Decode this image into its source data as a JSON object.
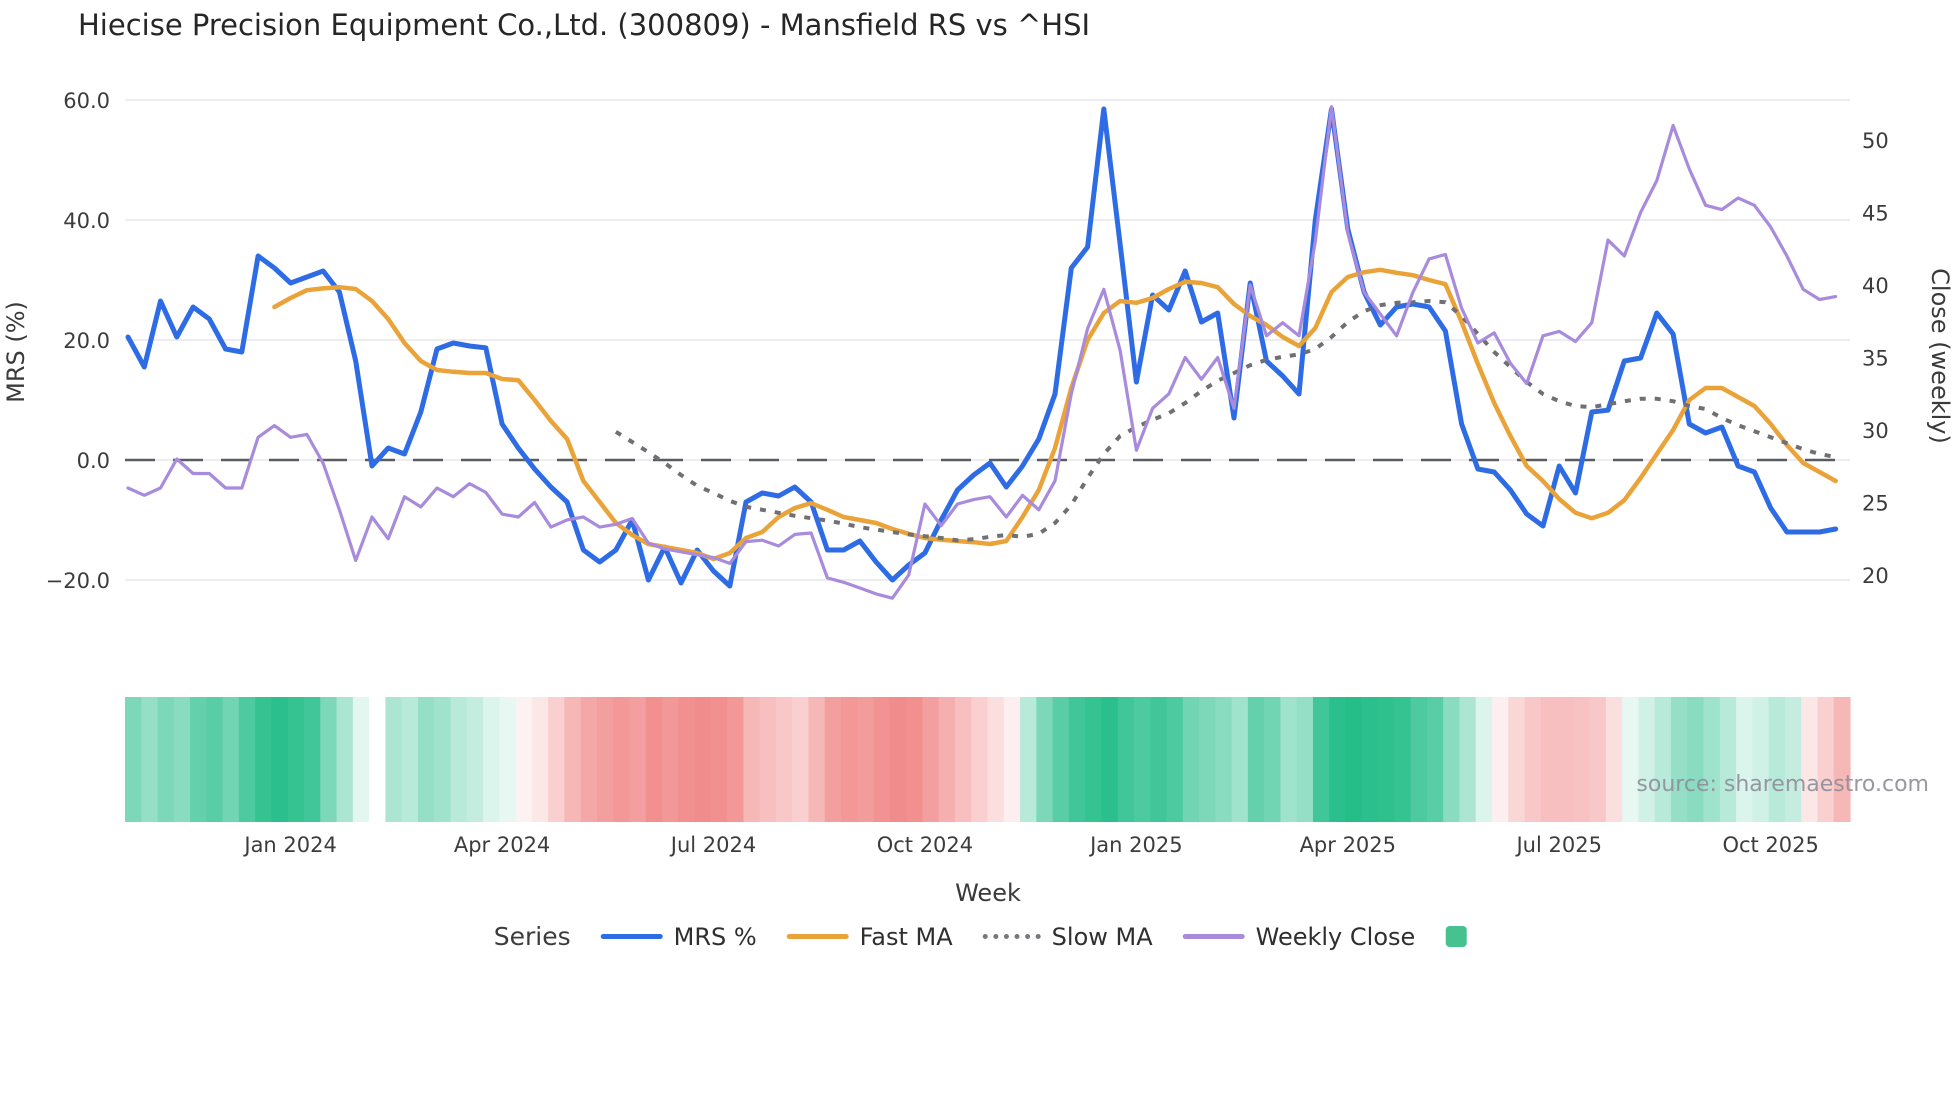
{
  "header": {
    "title": "Hiecise Precision Equipment Co.,Ltd. (300809) - Mansfield RS vs ^HSI"
  },
  "source_note": "source: sharemaestro.com",
  "legend": {
    "title": "Series",
    "items": [
      {
        "label": "MRS %",
        "swatch": "line",
        "color": "#2e6ce5"
      },
      {
        "label": "Fast MA",
        "swatch": "line",
        "color": "#eaa339"
      },
      {
        "label": "Slow MA",
        "swatch": "dotted",
        "color": "#77777c"
      },
      {
        "label": "Weekly Close",
        "swatch": "line",
        "color": "#a88bdc"
      },
      {
        "label": "",
        "swatch": "square",
        "color": "#45c28f"
      }
    ]
  },
  "chart_data": {
    "type": "line",
    "title": "Hiecise Precision Equipment Co.,Ltd. (300809) - Mansfield RS vs ^HSI",
    "xlabel": "Week",
    "x_tick_labels": [
      "Jan 2024",
      "Apr 2024",
      "Jul 2024",
      "Oct 2024",
      "Jan 2025",
      "Apr 2025",
      "Jul 2025",
      "Oct 2025"
    ],
    "x_tick_weeks": [
      10,
      23,
      36,
      49,
      62,
      75,
      88,
      101
    ],
    "weeks_total": 106,
    "grid": true,
    "y_left": {
      "label": "MRS (%)",
      "tick_labels": [
        "60.0",
        "40.0",
        "20.0",
        "0.0",
        "−20.0"
      ],
      "tick_values": [
        60,
        40,
        20,
        0,
        -20
      ],
      "zero_line": 0,
      "range": [
        -25,
        62
      ]
    },
    "y_right": {
      "label": "Close (weekly)",
      "tick_labels": [
        "50",
        "45",
        "40",
        "35",
        "30",
        "25",
        "20"
      ],
      "tick_values": [
        50,
        45,
        40,
        35,
        30,
        25,
        20
      ],
      "range": [
        18,
        53
      ]
    },
    "series": [
      {
        "name": "MRS %",
        "axis": "left",
        "color": "#2e6ce5",
        "style": "solid",
        "width": 5,
        "values": [
          20.5,
          15.5,
          26.5,
          20.5,
          25.5,
          23.5,
          18.5,
          18.0,
          34.0,
          32.0,
          29.5,
          30.5,
          31.5,
          28.0,
          16.5,
          -1.0,
          2.0,
          1.0,
          8.0,
          18.5,
          19.5,
          19.0,
          18.7,
          6.0,
          2.0,
          -1.5,
          -4.5,
          -7.0,
          -15.0,
          -17.0,
          -15.0,
          -10.0,
          -20.0,
          -14.5,
          -20.5,
          -15.0,
          -18.5,
          -21.0,
          -7.0,
          -5.5,
          -6.0,
          -4.5,
          -7.0,
          -15.0,
          -15.0,
          -13.5,
          -17.0,
          -20.0,
          -17.5,
          -15.5,
          -10.0,
          -5.0,
          -2.5,
          -0.5,
          -4.5,
          -1.0,
          3.5,
          11.0,
          32.0,
          35.5,
          58.5,
          36.0,
          13.0,
          27.5,
          25.0,
          31.5,
          23.0,
          24.5,
          7.0,
          29.5,
          16.5,
          14.0,
          11.0,
          40.0,
          58.5,
          38.5,
          28.0,
          22.5,
          25.5,
          26.0,
          25.5,
          21.5,
          6.0,
          -1.5,
          -2.0,
          -5.0,
          -9.0,
          -11.0,
          -1.0,
          -5.5,
          8.0,
          8.3,
          16.5,
          17.0,
          24.5,
          21.0,
          6.0,
          4.5,
          5.5,
          -1.0,
          -2.0,
          -8.0,
          -12.0,
          -12.0,
          -12.0,
          -11.5
        ]
      },
      {
        "name": "Fast MA",
        "axis": "left",
        "color": "#eaa339",
        "style": "solid",
        "width": 4.5,
        "values": [
          null,
          null,
          null,
          null,
          null,
          null,
          null,
          null,
          null,
          25.5,
          27.0,
          28.3,
          28.6,
          28.8,
          28.5,
          26.5,
          23.5,
          19.5,
          16.5,
          15.0,
          14.7,
          14.5,
          14.5,
          13.5,
          13.3,
          10.0,
          6.5,
          3.5,
          -3.5,
          -7.0,
          -10.5,
          -12.5,
          -14.0,
          -14.5,
          -15.0,
          -15.5,
          -16.5,
          -15.5,
          -13.0,
          -12.0,
          -9.5,
          -8.0,
          -7.2,
          -8.3,
          -9.5,
          -10.0,
          -10.5,
          -11.5,
          -12.3,
          -13.0,
          -13.3,
          -13.5,
          -13.7,
          -14.0,
          -13.5,
          -9.5,
          -5.0,
          2.0,
          12.0,
          20.0,
          24.5,
          26.5,
          26.2,
          27.0,
          28.5,
          29.7,
          29.5,
          28.8,
          26.0,
          24.0,
          22.5,
          20.5,
          19.0,
          22.0,
          28.0,
          30.5,
          31.3,
          31.7,
          31.2,
          30.8,
          30.0,
          29.3,
          23.0,
          16.0,
          9.5,
          4.0,
          -1.0,
          -3.5,
          -6.5,
          -8.8,
          -9.7,
          -8.8,
          -6.7,
          -3.0,
          1.0,
          5.0,
          10.0,
          12.0,
          12.0,
          10.5,
          9.0,
          6.0,
          2.5,
          -0.5,
          -2.0,
          -3.5
        ]
      },
      {
        "name": "Slow MA",
        "axis": "left",
        "color": "#6f6f74",
        "style": "dotted",
        "width": 4,
        "values": [
          null,
          null,
          null,
          null,
          null,
          null,
          null,
          null,
          null,
          null,
          null,
          null,
          null,
          null,
          null,
          null,
          null,
          null,
          null,
          null,
          null,
          null,
          null,
          null,
          null,
          null,
          null,
          null,
          null,
          null,
          4.7,
          3.0,
          1.3,
          -0.5,
          -2.5,
          -4.3,
          -5.5,
          -6.8,
          -7.8,
          -8.3,
          -8.8,
          -9.3,
          -9.7,
          -10.1,
          -10.6,
          -11.2,
          -11.6,
          -12.0,
          -12.4,
          -12.7,
          -13.0,
          -13.4,
          -13.2,
          -12.8,
          -12.5,
          -12.8,
          -12.3,
          -10.5,
          -7.5,
          -3.0,
          1.0,
          4.0,
          5.5,
          6.7,
          7.8,
          9.5,
          11.5,
          13.2,
          14.5,
          15.8,
          16.7,
          17.2,
          17.6,
          18.5,
          20.5,
          23.0,
          24.8,
          25.8,
          26.2,
          26.3,
          26.5,
          26.3,
          24.0,
          21.0,
          18.0,
          15.5,
          13.0,
          11.0,
          9.8,
          9.0,
          8.8,
          9.3,
          9.8,
          10.2,
          10.2,
          9.8,
          9.0,
          8.5,
          7.0,
          5.8,
          4.8,
          3.8,
          2.8,
          1.8,
          1.0,
          0.5
        ]
      },
      {
        "name": "Weekly Close",
        "axis": "right",
        "color": "#a88bdc",
        "style": "solid",
        "width": 3.2,
        "values": [
          26.0,
          25.5,
          26.0,
          28.0,
          27.0,
          27.0,
          26.0,
          26.0,
          29.5,
          30.3,
          29.5,
          29.7,
          27.7,
          24.5,
          21.0,
          24.0,
          22.5,
          25.4,
          24.7,
          26.0,
          25.4,
          26.3,
          25.7,
          24.2,
          24.0,
          25.0,
          23.3,
          23.8,
          24.0,
          23.3,
          23.5,
          23.9,
          22.2,
          21.8,
          21.6,
          21.4,
          21.2,
          20.8,
          22.3,
          22.4,
          22.0,
          22.8,
          22.9,
          19.8,
          19.5,
          19.1,
          18.7,
          18.4,
          20.0,
          24.9,
          23.4,
          24.9,
          25.2,
          25.4,
          24.0,
          25.5,
          24.5,
          26.5,
          32.5,
          37.0,
          39.7,
          35.5,
          28.6,
          31.5,
          32.5,
          35.0,
          33.5,
          35.0,
          31.5,
          40.0,
          36.5,
          37.4,
          36.5,
          43.0,
          52.3,
          43.6,
          39.5,
          38.0,
          36.5,
          39.5,
          41.8,
          42.1,
          38.4,
          36.0,
          36.7,
          34.6,
          33.2,
          36.5,
          36.8,
          36.1,
          37.4,
          43.1,
          42.0,
          45.0,
          47.2,
          51.0,
          48.0,
          45.5,
          45.2,
          46.0,
          45.5,
          44.0,
          42.0,
          39.7,
          39.0,
          39.2
        ]
      }
    ],
    "heatmap": {
      "positive_color": "#12b87f",
      "negative_color": "#ec5f5f",
      "neutral_color": "#ffffff",
      "values": [
        0.55,
        0.45,
        0.55,
        0.5,
        0.65,
        0.7,
        0.6,
        0.75,
        0.85,
        0.9,
        0.85,
        0.8,
        0.55,
        0.35,
        0.12,
        0,
        0.35,
        0.3,
        0.45,
        0.4,
        0.3,
        0.25,
        0.15,
        0.1,
        -0.08,
        -0.15,
        -0.3,
        -0.45,
        -0.55,
        -0.6,
        -0.65,
        -0.6,
        -0.7,
        -0.65,
        -0.7,
        -0.72,
        -0.7,
        -0.65,
        -0.45,
        -0.4,
        -0.35,
        -0.3,
        -0.45,
        -0.6,
        -0.65,
        -0.62,
        -0.68,
        -0.72,
        -0.7,
        -0.6,
        -0.5,
        -0.4,
        -0.3,
        -0.2,
        -0.1,
        0.3,
        0.55,
        0.7,
        0.8,
        0.85,
        0.9,
        0.8,
        0.75,
        0.8,
        0.75,
        0.6,
        0.55,
        0.5,
        0.4,
        0.65,
        0.6,
        0.4,
        0.45,
        0.8,
        0.9,
        0.92,
        0.9,
        0.88,
        0.85,
        0.75,
        0.7,
        0.5,
        0.35,
        0.15,
        -0.1,
        -0.25,
        -0.35,
        -0.4,
        -0.4,
        -0.38,
        -0.35,
        -0.2,
        0.1,
        0.2,
        0.3,
        0.45,
        0.5,
        0.4,
        0.3,
        0.15,
        0.2,
        0.3,
        0.25,
        -0.15,
        -0.3,
        -0.45
      ]
    },
    "colors": {
      "grid": "#ededf1",
      "zero_dash": "#595d63",
      "tick_text": "#3c3c3c"
    }
  }
}
